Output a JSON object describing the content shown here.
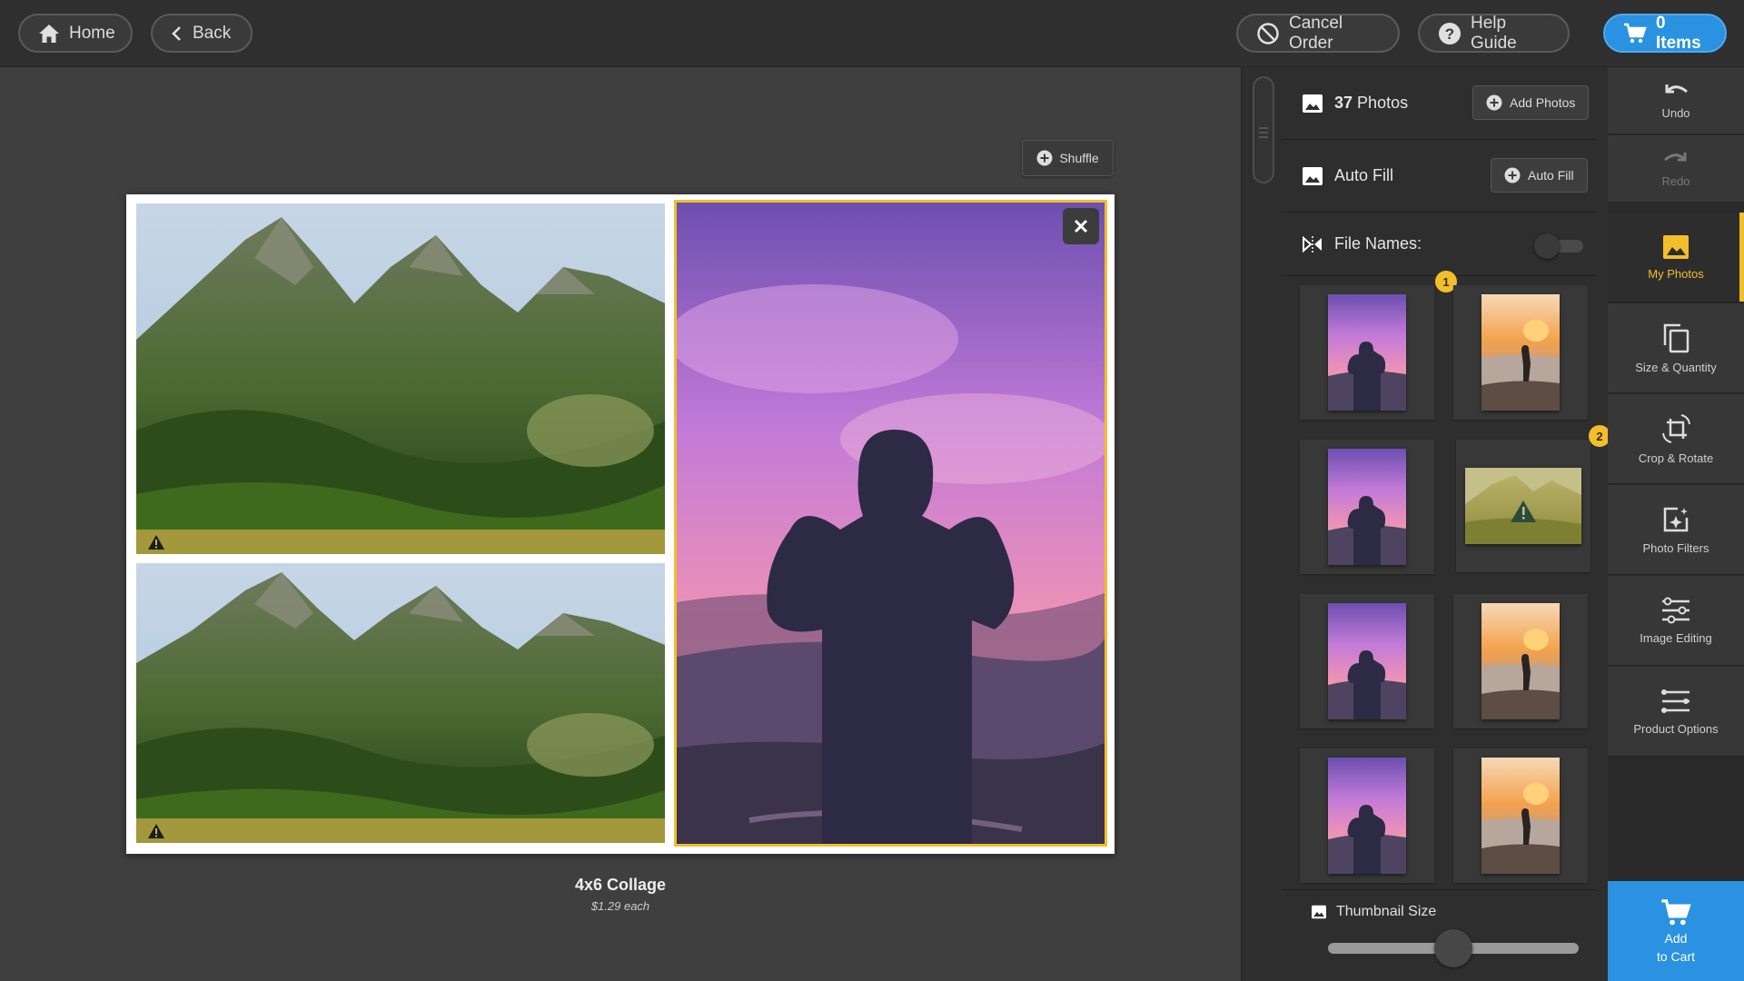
{
  "topbar": {
    "home_label": "Home",
    "back_label": "Back",
    "cancel_label": "Cancel Order",
    "help_label": "Help Guide",
    "cart_label": "0 Items"
  },
  "canvas": {
    "shuffle_label": "Shuffle",
    "product_title": "4x6 Collage",
    "product_price": "$1.29 each"
  },
  "photos_panel": {
    "photos_count": "37",
    "photos_label": "Photos",
    "add_photos_label": "Add Photos",
    "auto_fill_label": "Auto Fill",
    "auto_fill_button_label": "Auto Fill",
    "file_names_label": "File Names:",
    "file_names_enabled": false,
    "thumbnails": [
      {
        "kind": "sunset-silhouette",
        "badge": "1"
      },
      {
        "kind": "beach-walker"
      },
      {
        "kind": "sunset-silhouette"
      },
      {
        "kind": "mountain-warning",
        "badge": "2"
      },
      {
        "kind": "sunset-silhouette"
      },
      {
        "kind": "beach-walker"
      },
      {
        "kind": "sunset-silhouette"
      },
      {
        "kind": "beach-walker"
      }
    ],
    "thumbnail_size_label": "Thumbnail Size",
    "thumbnail_size_fraction": 0.5
  },
  "nav": {
    "undo": "Undo",
    "redo": "Redo",
    "my_photos": "My Photos",
    "size_quantity": "Size & Quantity",
    "crop_rotate": "Crop & Rotate",
    "photo_filters": "Photo Filters",
    "image_editing": "Image Editing",
    "product_options": "Product Options",
    "add_to_cart_line1": "Add",
    "add_to_cart_line2": "to Cart"
  },
  "colors": {
    "accent": "#f2be2c",
    "cart_blue": "#2a92e0",
    "warning_strip": "#caaa46"
  }
}
